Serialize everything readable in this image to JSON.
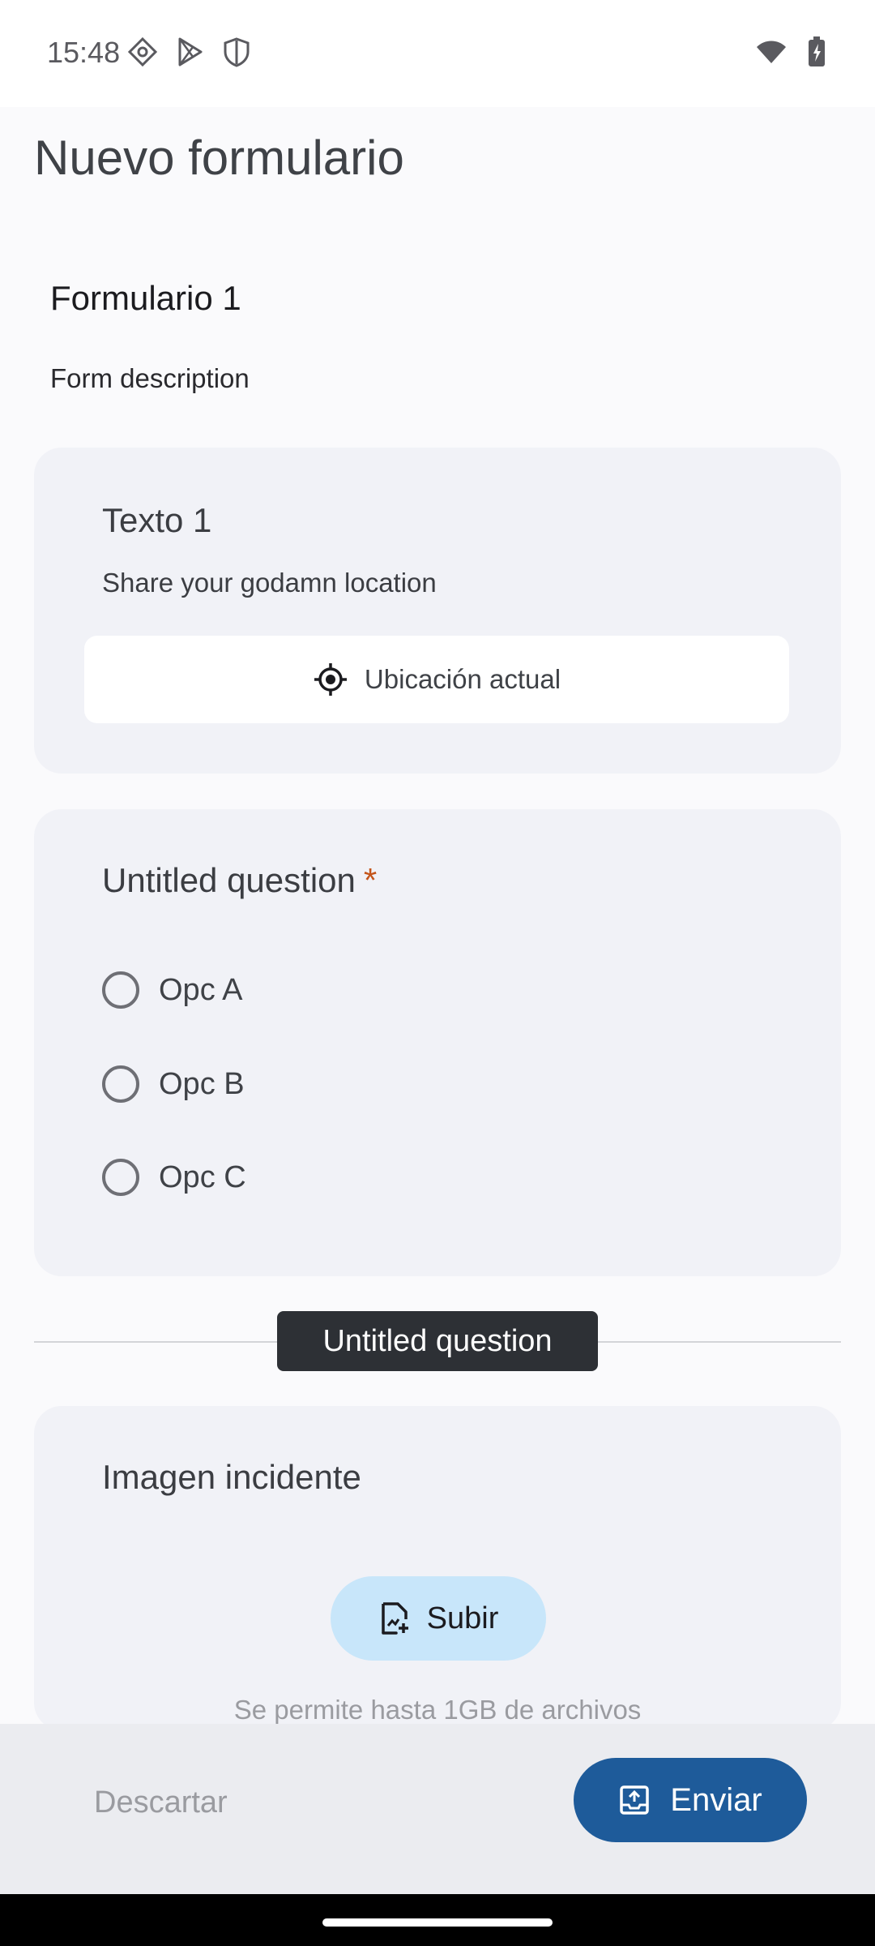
{
  "status_bar": {
    "time": "15:48",
    "icons_left": [
      "settings-diamond-icon",
      "play-store-icon",
      "shield-icon"
    ],
    "icons_right": [
      "wifi-icon",
      "battery-charging-icon"
    ]
  },
  "header": {
    "title": "Nuevo formulario"
  },
  "form": {
    "title": "Formulario 1",
    "description": "Form description"
  },
  "card_location": {
    "title": "Texto 1",
    "subtitle": "Share your godamn location",
    "button_label": "Ubicación actual",
    "button_icon": "my-location-icon"
  },
  "card_choice": {
    "title": "Untitled question",
    "required_mark": "*",
    "options": [
      "Opc A",
      "Opc B",
      "Opc C"
    ]
  },
  "section_tooltip": "Untitled question",
  "card_upload": {
    "title": "Imagen incidente",
    "button_label": "Subir",
    "button_icon": "upload-file-icon",
    "hint": "Se permite hasta 1GB de archivos"
  },
  "bottom_bar": {
    "discard_label": "Descartar",
    "send_label": "Enviar",
    "send_icon": "send-inbox-icon"
  },
  "colors": {
    "primary": "#1e5b9a",
    "upload_button_bg": "#c8e6fa",
    "required": "#c4551a",
    "card_bg": "#f1f2f7"
  }
}
